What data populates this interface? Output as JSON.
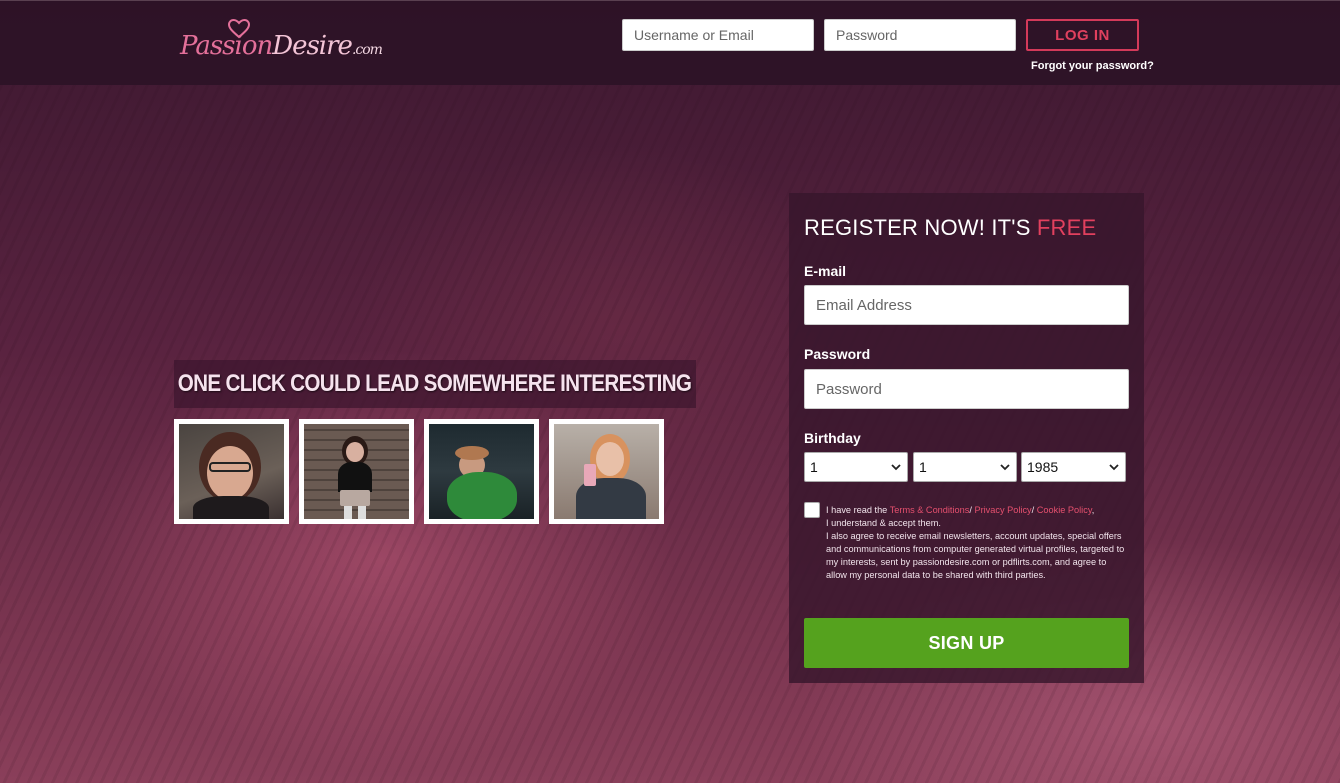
{
  "brand": {
    "logo_part1": "Passion",
    "logo_part2": "Desire",
    "logo_suffix": ".com",
    "logo_text": "PassionDesire.com",
    "accent_color": "#e2405e",
    "signup_color": "#55a21e"
  },
  "header": {
    "username_placeholder": "Username or Email",
    "password_placeholder": "Password",
    "login_label": "LOG IN",
    "forgot_label": "Forgot your password?"
  },
  "hero": {
    "tagline": "ONE CLICK COULD LEAD SOMEWHERE INTERESTING",
    "profiles": [
      {
        "icon": "profile-photo-1"
      },
      {
        "icon": "profile-photo-2"
      },
      {
        "icon": "profile-photo-3"
      },
      {
        "icon": "profile-photo-4"
      }
    ]
  },
  "register": {
    "title_main": "REGISTER NOW! IT'S ",
    "title_accent": "FREE",
    "email_label": "E-mail",
    "email_placeholder": "Email Address",
    "password_label": "Password",
    "password_placeholder": "Password",
    "birthday_label": "Birthday",
    "birthday_day": "1",
    "birthday_month": "1",
    "birthday_year": "1985",
    "terms_prefix": "I have read the ",
    "terms_link": "Terms & Conditions",
    "privacy_link": "Privacy Policy",
    "cookie_link": "Cookie Policy",
    "terms_accept": "I understand & accept them.",
    "terms_body": "I also agree to receive email newsletters, account updates, special offers and communications from computer generated virtual profiles, targeted to my interests, sent by passiondesire.com or pdflirts.com, and agree to allow my personal data to be shared with third parties.",
    "signup_label": "SIGN UP"
  }
}
